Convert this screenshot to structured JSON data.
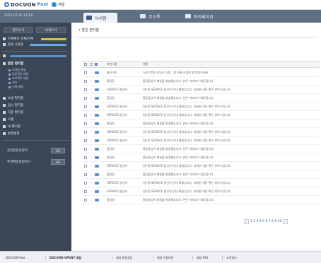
{
  "app": {
    "brand": "DOCUON",
    "edition": "Post",
    "tag": "메일"
  },
  "nav": {
    "datetime": "2012.07.16 14:08",
    "tabs": [
      {
        "label": "사서함"
      },
      {
        "label": "주소록"
      },
      {
        "label": "마이페이지"
      }
    ]
  },
  "sidebar": {
    "buttons": [
      "편지쓰기",
      "내게쓰기"
    ],
    "summary": [
      "전체편지 현재/전체",
      "용량 사용량"
    ],
    "folder_title": "받은 편지함",
    "subfolders": [
      "부재중 메일",
      "업무관련 메일",
      "프로젝트 메일",
      "기타",
      "스팸 메일"
    ],
    "folders": [
      "보낸 편지함",
      "임시 편지함",
      "지운 편지함",
      "스팸",
      "내 편지함",
      "환경설정"
    ],
    "selects": [
      {
        "label": "공인인증서관리",
        "value": "GO"
      },
      {
        "label": "추천메일설정하기",
        "value": "GO"
      }
    ]
  },
  "main": {
    "breadcrumb": "• 받은 편지함",
    "list_header": {
      "from": "보낸사람",
      "subject": "제목"
    },
    "rows": [
      {
        "from": "발신자A",
        "subject": "스토리북의 주인공 지원 : 봄 여름 인생의 봄 맞아보세요"
      },
      {
        "from": "홍길동",
        "subject": "홍길동님이 메일을 발송했습니다. 본문 미리보기 제공합니다."
      },
      {
        "from": "SERVICE 발신자",
        "subject": "[안내] SERVICE 발신자 안내 메일입니다. 자세한 내용 확인 부탁드립니다."
      },
      {
        "from": "홍길동",
        "subject": "홍길동님이 메일을 발송했습니다. 본문 미리보기 제공합니다."
      },
      {
        "from": "SERVICE 발신자",
        "subject": "[안내] SERVICE 발신자 안내 메일입니다. 자세한 내용 확인 부탁드립니다."
      },
      {
        "from": "SERVICE 발신자",
        "subject": "[안내] SERVICE 발신자 안내 메일입니다. 자세한 내용 확인 부탁드립니다."
      },
      {
        "from": "홍길동",
        "subject": "홍길동님이 메일을 발송했습니다. 본문 미리보기 제공합니다."
      },
      {
        "from": "SERVICE 발신자",
        "subject": "[안내] SERVICE 발신자 안내 메일입니다. 자세한 내용 확인 부탁드립니다."
      },
      {
        "from": "SERVICE 발신자",
        "subject": "[안내] SERVICE 발신자 안내 메일입니다. 자세한 내용 확인 부탁드립니다."
      },
      {
        "from": "홍길동",
        "subject": "홍길동님이 메일을 발송했습니다. 본문 미리보기 제공합니다."
      },
      {
        "from": "홍길동",
        "subject": "홍길동님이 메일을 발송했습니다. 본문 미리보기 제공합니다."
      },
      {
        "from": "SERVICE 발신자",
        "subject": "[안내] SERVICE 발신자 안내 메일입니다. 자세한 내용 확인 부탁드립니다."
      },
      {
        "from": "홍길동",
        "subject": "홍길동님이 메일을 발송했습니다. 본문 미리보기 제공합니다."
      },
      {
        "from": "SERVICE 발신자",
        "subject": "[안내] SERVICE 발신자 안내 메일입니다. 자세한 내용 확인 부탁드립니다."
      },
      {
        "from": "SERVICE 발신자",
        "subject": "[안내] SERVICE 발신자 안내 메일입니다. 자세한 내용 확인 부탁드립니다."
      },
      {
        "from": "홍길동",
        "subject": "홍길동님이 메일을 발송했습니다. 본문 미리보기 제공합니다."
      }
    ],
    "pager": {
      "prev": "‹",
      "next": "›",
      "pages": "1 2 3 4 5 6 7 8 9 10"
    }
  },
  "footer": {
    "tabs": [
      "DOCUON Post",
      "DOCUON UPOST 메일",
      "메일 환경설정",
      "메일 이용약관",
      "메일 FAQ",
      "고객센터"
    ]
  },
  "colors": {
    "nav": "#5f6f84",
    "sidebar": "#3b4757",
    "accent": "#2f78c6"
  }
}
